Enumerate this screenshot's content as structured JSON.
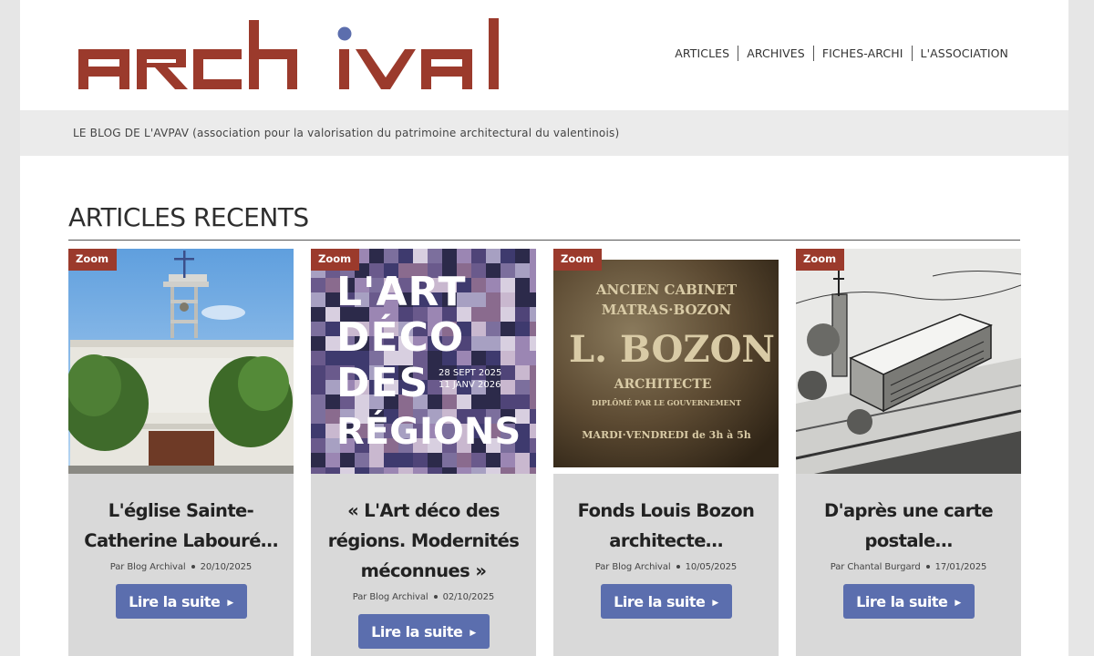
{
  "brand": {
    "logo_text": "archival",
    "accent": "#9b3a2c",
    "dot": "#5c6ead"
  },
  "nav": [
    {
      "label": "ARTICLES"
    },
    {
      "label": "ARCHIVES"
    },
    {
      "label": "FICHES-ARCHI"
    },
    {
      "label": "L'ASSOCIATION"
    }
  ],
  "tagline": "LE BLOG DE L'AVPAV (association pour la valorisation du patrimoine architectural du valentinois)",
  "section": {
    "title": "ARTICLES RECENTS"
  },
  "cards": [
    {
      "badge": "Zoom",
      "title": "L'église Sainte-Catherine Labouré…",
      "author": "Par Blog Archival",
      "date": "20/10/2025",
      "cta": "Lire la suite"
    },
    {
      "badge": "Zoom",
      "title": "« L'Art déco des régions. Modernités méconnues »",
      "author": "Par Blog Archival",
      "date": "02/10/2025",
      "cta": "Lire la suite",
      "poster": {
        "line1": "L'ART",
        "line2": "DÉCO",
        "line3": "DES",
        "line4": "RÉGIONS",
        "date1": "28 SEPT 2025",
        "date2": "11 JANV 2026"
      }
    },
    {
      "badge": "Zoom",
      "title": "Fonds Louis Bozon architecte…",
      "author": "Par Blog Archival",
      "date": "10/05/2025",
      "cta": "Lire la suite",
      "plaque": {
        "line1": "ANCIEN CABINET",
        "line2": "MATRAS·BOZON",
        "line3": "L. BOZON",
        "line4": "ARCHITECTE",
        "line5": "DIPLÔMÉ PAR LE GOUVERNEMENT",
        "line6": "MARDI·VENDREDI de 3h à 5h"
      }
    },
    {
      "badge": "Zoom",
      "title": "D'après une carte postale…",
      "author": "Par Chantal Burgard",
      "date": "17/01/2025",
      "cta": "Lire la suite"
    }
  ]
}
